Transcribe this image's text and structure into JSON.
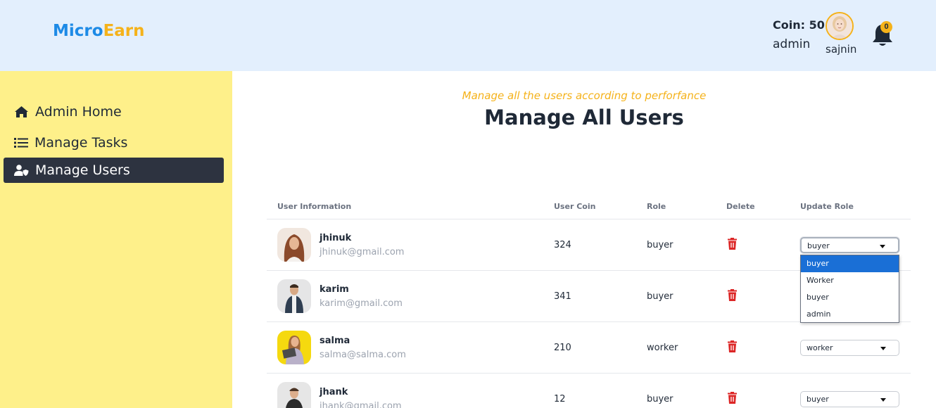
{
  "header": {
    "logo_part1": "Micro",
    "logo_part2": "Earn",
    "coin_text": "Coin: 50",
    "user_role": "admin",
    "user_name": "sajnin",
    "notification_count": "0"
  },
  "sidebar": {
    "items": [
      {
        "label": "Admin Home",
        "icon": "home-icon"
      },
      {
        "label": "Manage Tasks",
        "icon": "list-icon"
      },
      {
        "label": "Manage Users",
        "icon": "user-shield-icon",
        "active": true
      }
    ]
  },
  "page": {
    "subtitle": "Manage all the users according to perforfance",
    "title": "Manage All Users"
  },
  "table": {
    "headers": [
      "User Information",
      "User Coin",
      "Role",
      "Delete",
      "Update Role"
    ],
    "rows": [
      {
        "name": "jhinuk",
        "email": "jhinuk@gmail.com",
        "coin": "324",
        "role": "buyer",
        "select_value": "buyer"
      },
      {
        "name": "karim",
        "email": "karim@gmail.com",
        "coin": "341",
        "role": "buyer",
        "select_value": "buyer"
      },
      {
        "name": "salma",
        "email": "salma@salma.com",
        "coin": "210",
        "role": "worker",
        "select_value": "worker"
      },
      {
        "name": "jhank",
        "email": "jhank@gmail.com",
        "coin": "12",
        "role": "buyer",
        "select_value": "buyer"
      }
    ]
  },
  "dropdown": {
    "options": [
      "buyer",
      "Worker",
      "buyer",
      "admin"
    ],
    "selected_index": 0
  },
  "colors": {
    "header_bg": "#e3effd",
    "sidebar_bg": "#fef08a",
    "active_nav_bg": "#2d3340",
    "accent_yellow": "#f5b21a",
    "logo_blue": "#1d8ae6",
    "delete_red": "#dc2626",
    "dropdown_highlight": "#1a6fd6"
  }
}
